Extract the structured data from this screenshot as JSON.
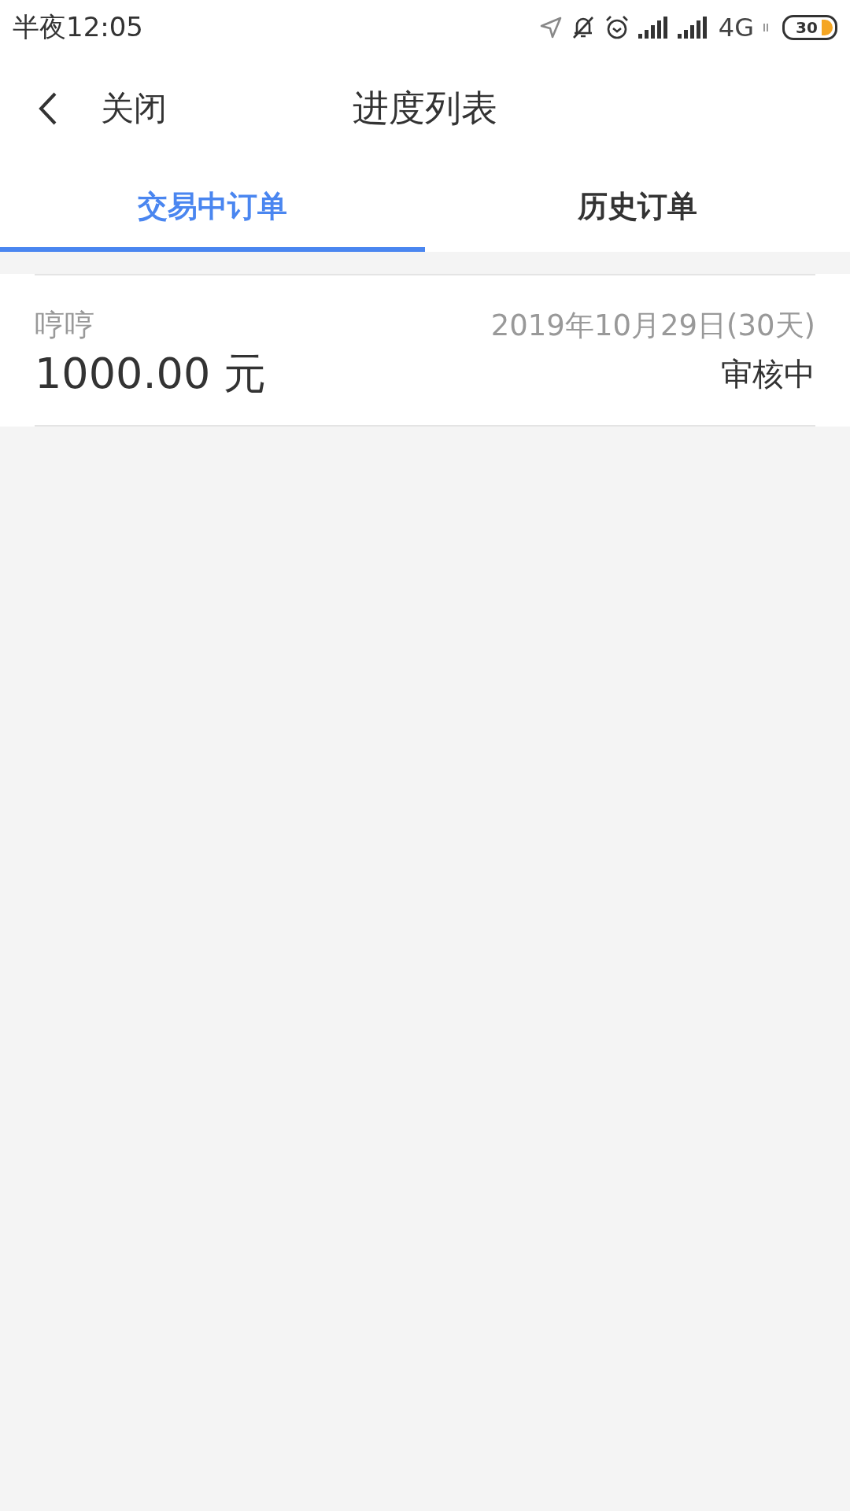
{
  "status_bar": {
    "time": "半夜12:05",
    "network": "4G",
    "battery": "30"
  },
  "header": {
    "back_label": "关闭",
    "title": "进度列表"
  },
  "tabs": [
    {
      "label": "交易中订单",
      "selected": true
    },
    {
      "label": "历史订单",
      "selected": false
    }
  ],
  "orders": [
    {
      "name": "哼哼",
      "date": "2019年10月29日(30天)",
      "amount": "1000.00 元",
      "status": "审核中"
    }
  ]
}
